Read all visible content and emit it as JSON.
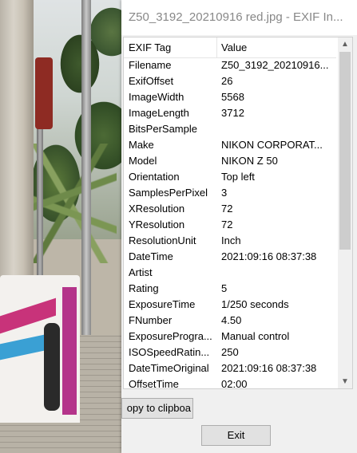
{
  "window": {
    "title": "Z50_3192_20210916 red.jpg - EXIF In..."
  },
  "table": {
    "headers": {
      "tag": "EXIF Tag",
      "value": "Value"
    },
    "rows": [
      {
        "tag": "Filename",
        "value": "Z50_3192_20210916..."
      },
      {
        "tag": "ExifOffset",
        "value": "26"
      },
      {
        "tag": "ImageWidth",
        "value": "5568"
      },
      {
        "tag": "ImageLength",
        "value": "3712"
      },
      {
        "tag": "BitsPerSample",
        "value": ""
      },
      {
        "tag": "Make",
        "value": "NIKON CORPORAT..."
      },
      {
        "tag": "Model",
        "value": "NIKON Z 50"
      },
      {
        "tag": "Orientation",
        "value": "Top left"
      },
      {
        "tag": "SamplesPerPixel",
        "value": "3"
      },
      {
        "tag": "XResolution",
        "value": "72"
      },
      {
        "tag": "YResolution",
        "value": "72"
      },
      {
        "tag": "ResolutionUnit",
        "value": "Inch"
      },
      {
        "tag": "DateTime",
        "value": "2021:09:16 08:37:38"
      },
      {
        "tag": "Artist",
        "value": ""
      },
      {
        "tag": "Rating",
        "value": "5"
      },
      {
        "tag": "ExposureTime",
        "value": "1/250 seconds"
      },
      {
        "tag": "FNumber",
        "value": "4.50"
      },
      {
        "tag": "ExposureProgra...",
        "value": "Manual control"
      },
      {
        "tag": "ISOSpeedRatin...",
        "value": "250"
      },
      {
        "tag": "DateTimeOriginal",
        "value": "2021:09:16 08:37:38"
      },
      {
        "tag": "OffsetTime",
        "value": "02:00"
      }
    ]
  },
  "scrollbar": {
    "up_glyph": "▲",
    "down_glyph": "▼"
  },
  "buttons": {
    "copy_label": "opy to clipboa",
    "exit_label": "Exit"
  }
}
